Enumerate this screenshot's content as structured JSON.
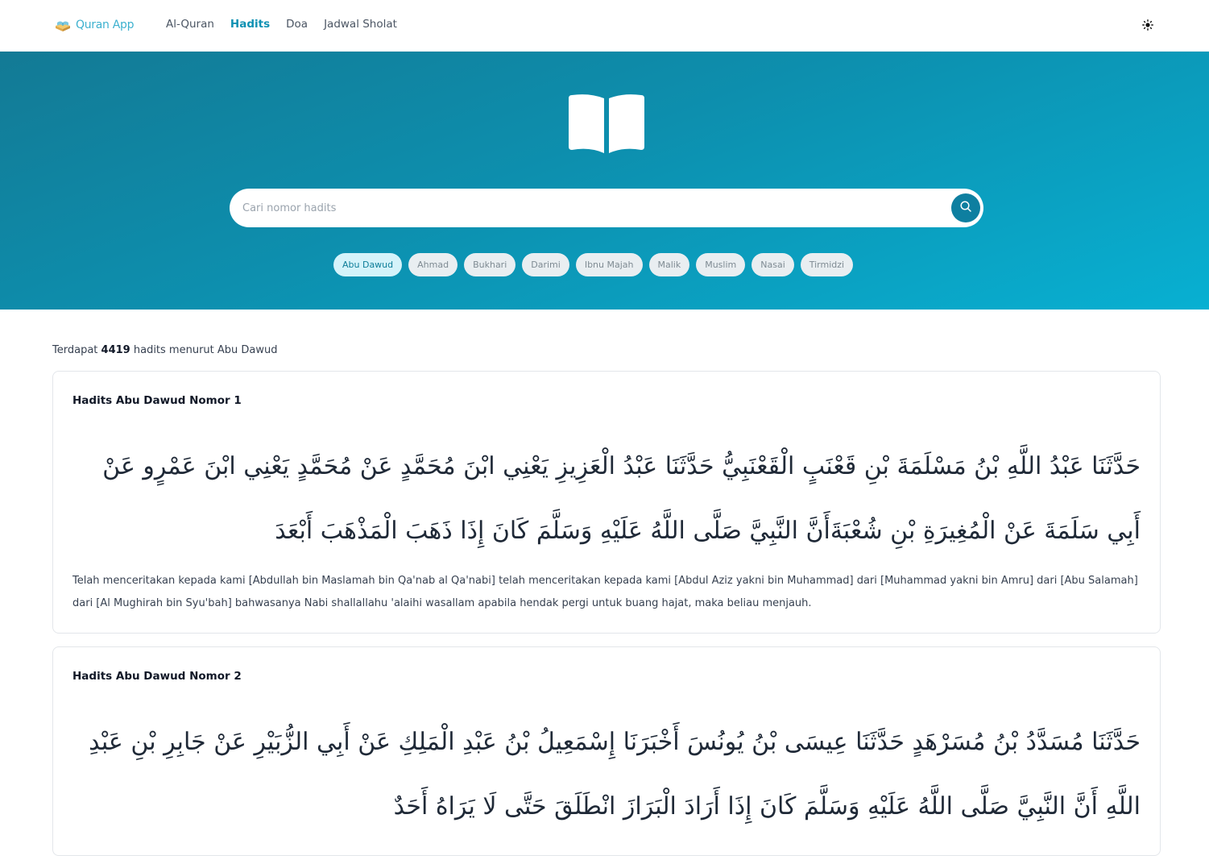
{
  "nav": {
    "brand": "Quran App",
    "links": [
      "Al-Quran",
      "Hadits",
      "Doa",
      "Jadwal Sholat"
    ],
    "active": "Hadits",
    "theme_icon": "sun-icon"
  },
  "hero": {
    "icon": "open-book-icon",
    "search_placeholder": "Cari nomor hadits",
    "search_icon": "search-icon",
    "chips": [
      "Abu Dawud",
      "Ahmad",
      "Bukhari",
      "Darimi",
      "Ibnu Majah",
      "Malik",
      "Muslim",
      "Nasai",
      "Tirmidzi"
    ],
    "active_chip": "Abu Dawud"
  },
  "summary": {
    "prefix": "Terdapat",
    "count": "4419",
    "suffix": "hadits menurut Abu Dawud"
  },
  "hadiths": [
    {
      "title": "Hadits Abu Dawud Nomor 1",
      "arabic": "حَدَّثَنَا عَبْدُ اللَّهِ بْنُ مَسْلَمَةَ بْنِ قَعْنَبٍ الْقَعْنَبِيُّ حَدَّثَنَا عَبْدُ الْعَزِيزِ يَعْنِي ابْنَ مُحَمَّدٍ عَنْ مُحَمَّدٍ يَعْنِي ابْنَ عَمْرٍو عَنْ أَبِي سَلَمَةَ عَنْ الْمُغِيرَةِ بْنِ شُعْبَةَأَنَّ النَّبِيَّ صَلَّى اللَّهُ عَلَيْهِ وَسَلَّمَ كَانَ إِذَا ذَهَبَ الْمَذْهَبَ أَبْعَدَ",
      "translation": "Telah menceritakan kepada kami [Abdullah bin Maslamah bin Qa'nab al Qa'nabi] telah menceritakan kepada kami [Abdul Aziz yakni bin Muhammad] dari [Muhammad yakni bin Amru] dari [Abu Salamah] dari [Al Mughirah bin Syu'bah] bahwasanya Nabi shallallahu 'alaihi wasallam apabila hendak pergi untuk buang hajat, maka beliau menjauh."
    },
    {
      "title": "Hadits Abu Dawud Nomor 2",
      "arabic": "حَدَّثَنَا مُسَدَّدُ بْنُ مُسَرْهَدٍ حَدَّثَنَا عِيسَى بْنُ يُونُسَ أَخْبَرَنَا إِسْمَعِيلُ بْنُ عَبْدِ الْمَلِكِ عَنْ أَبِي الزُّبَيْرِ عَنْ جَابِرِ بْنِ عَبْدِ اللَّهِ أَنَّ النَّبِيَّ صَلَّى اللَّهُ عَلَيْهِ وَسَلَّمَ كَانَ إِذَا أَرَادَ الْبَرَازَ انْطَلَقَ حَتَّى لَا يَرَاهُ أَحَدٌ"
    }
  ],
  "colors": {
    "accent": "#0e91b3",
    "hero_start": "#137a95",
    "hero_end": "#08b0d2",
    "chip_active_bg": "#d4f3fa"
  }
}
